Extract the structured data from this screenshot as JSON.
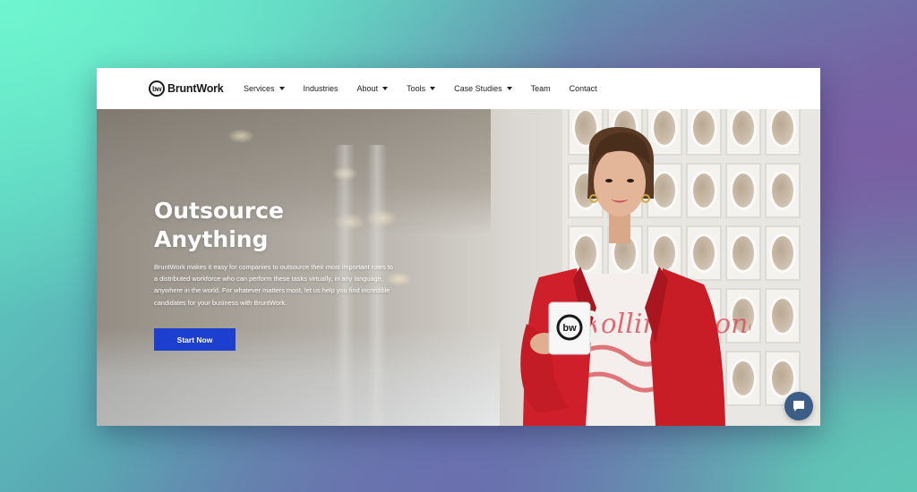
{
  "header": {
    "logo_mark": "bw",
    "logo_text": "BruntWork",
    "nav": [
      {
        "label": "Services",
        "dropdown": true
      },
      {
        "label": "Industries",
        "dropdown": false
      },
      {
        "label": "About",
        "dropdown": true
      },
      {
        "label": "Tools",
        "dropdown": true
      },
      {
        "label": "Case Studies",
        "dropdown": true
      },
      {
        "label": "Team",
        "dropdown": false
      },
      {
        "label": "Contact",
        "dropdown": false
      }
    ]
  },
  "hero": {
    "title_line1": "Outsource",
    "title_line2": "Anything",
    "body": "BruntWork makes it easy for companies to outsource their most important roles to a distributed workforce who can perform these tasks virtually, in any language, anywhere in the world. For whatever matters most, let us help you find incredible candidates for your business with BruntWork.",
    "cta_label": "Start Now",
    "mug_logo": "bw",
    "shirt_text": "Rolling Stones"
  },
  "chat_widget": {
    "icon": "chat-bubble-icon"
  },
  "colors": {
    "cta_bg": "#1d3fcf",
    "chat_bg": "#3c5e86",
    "blazer": "#d3202b",
    "header_bg": "#ffffff"
  }
}
